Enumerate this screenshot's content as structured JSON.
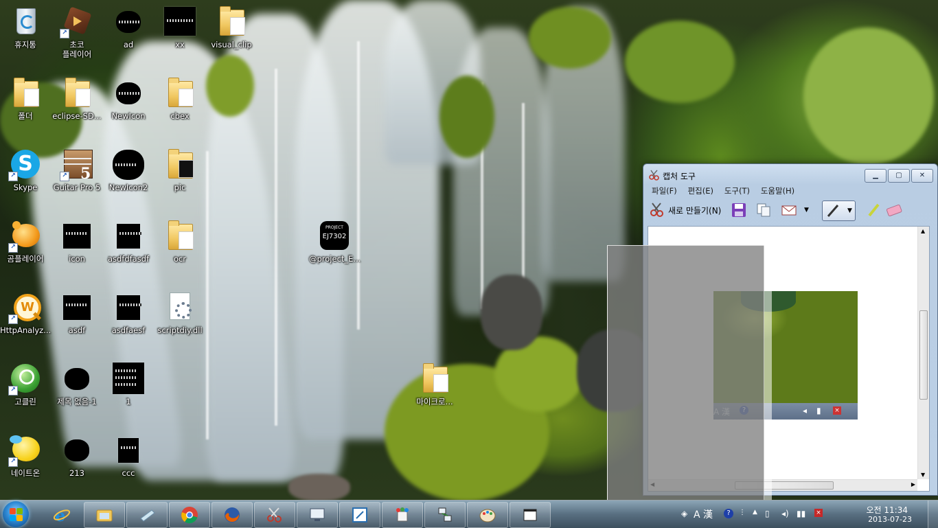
{
  "desktop": {
    "icons": [
      {
        "label": "휴지통",
        "icon": "recycle-bin-icon"
      },
      {
        "label": "초코\n플레이어",
        "icon": "choco-player-icon"
      },
      {
        "label": "ad",
        "icon": "black-image-icon"
      },
      {
        "label": "xx",
        "icon": "black-image-icon"
      },
      {
        "label": "visual_clip",
        "icon": "folder-icon"
      },
      {
        "label": "폴더",
        "icon": "folder-icon"
      },
      {
        "label": "eclipse-SD...",
        "icon": "folder-icon"
      },
      {
        "label": "NewIcon",
        "icon": "black-image-icon"
      },
      {
        "label": "cbex",
        "icon": "folder-icon"
      },
      {
        "label": "Skype",
        "icon": "skype-icon"
      },
      {
        "label": "Guitar Pro 5",
        "icon": "guitar-pro-icon"
      },
      {
        "label": "NewIcon2",
        "icon": "black-image-icon"
      },
      {
        "label": "pic",
        "icon": "folder-icon"
      },
      {
        "label": "곰플레이어",
        "icon": "gom-player-icon"
      },
      {
        "label": "icon",
        "icon": "black-image-icon"
      },
      {
        "label": "asdfdfasdf",
        "icon": "black-image-icon"
      },
      {
        "label": "ocr",
        "icon": "folder-icon"
      },
      {
        "label": "@project_E...",
        "icon": "project-ej-icon"
      },
      {
        "label": "HttpAnalyz...",
        "icon": "http-analyzer-icon"
      },
      {
        "label": "asdf",
        "icon": "black-image-icon"
      },
      {
        "label": "asdfaesf",
        "icon": "black-image-icon"
      },
      {
        "label": "scriptdiy.dll",
        "icon": "dll-file-icon"
      },
      {
        "label": "고클린",
        "icon": "goclean-icon"
      },
      {
        "label": "제목 없음-1",
        "icon": "black-image-icon"
      },
      {
        "label": "1",
        "icon": "black-image-icon"
      },
      {
        "label": "마이크로...",
        "icon": "folder-icon"
      },
      {
        "label": "네이트온",
        "icon": "nateon-icon"
      },
      {
        "label": "213",
        "icon": "black-image-icon"
      },
      {
        "label": "ccc",
        "icon": "black-image-icon"
      }
    ],
    "project_logo_text": "PROJECT",
    "project_logo_sub": "EJ7302"
  },
  "snipping_tool": {
    "title": "캡처 도구",
    "menu": [
      "파일(F)",
      "편집(E)",
      "도구(T)",
      "도움말(H)"
    ],
    "new_button": "새로 만들기(N)",
    "controls": {
      "minimize": "▁",
      "maximize": "▢",
      "close": "✕"
    },
    "captured_taskbar_text": "A 漢"
  },
  "taskbar": {
    "apps": [
      {
        "name": "internet-explorer",
        "icon": "ie-icon"
      },
      {
        "name": "windows-explorer",
        "icon": "explorer-icon"
      },
      {
        "name": "notepad",
        "icon": "notepad-icon"
      },
      {
        "name": "chrome",
        "icon": "chrome-icon"
      },
      {
        "name": "firefox",
        "icon": "firefox-icon"
      },
      {
        "name": "snipping-tool",
        "icon": "scissors-icon"
      },
      {
        "name": "remote-desktop",
        "icon": "monitor-icon"
      },
      {
        "name": "editor",
        "icon": "edit-icon"
      },
      {
        "name": "paint-bucket",
        "icon": "paint-icon"
      },
      {
        "name": "network-tool",
        "icon": "network-icon"
      },
      {
        "name": "paint",
        "icon": "palette-icon"
      },
      {
        "name": "window",
        "icon": "window-icon"
      }
    ],
    "ime_text": "A 漢",
    "clock_time": "오전 11:34",
    "clock_date": "2013-07-23"
  },
  "colors": {
    "taskbar": "#4a6275",
    "window_frame": "#bcd0e6",
    "overlay": "#808080"
  }
}
